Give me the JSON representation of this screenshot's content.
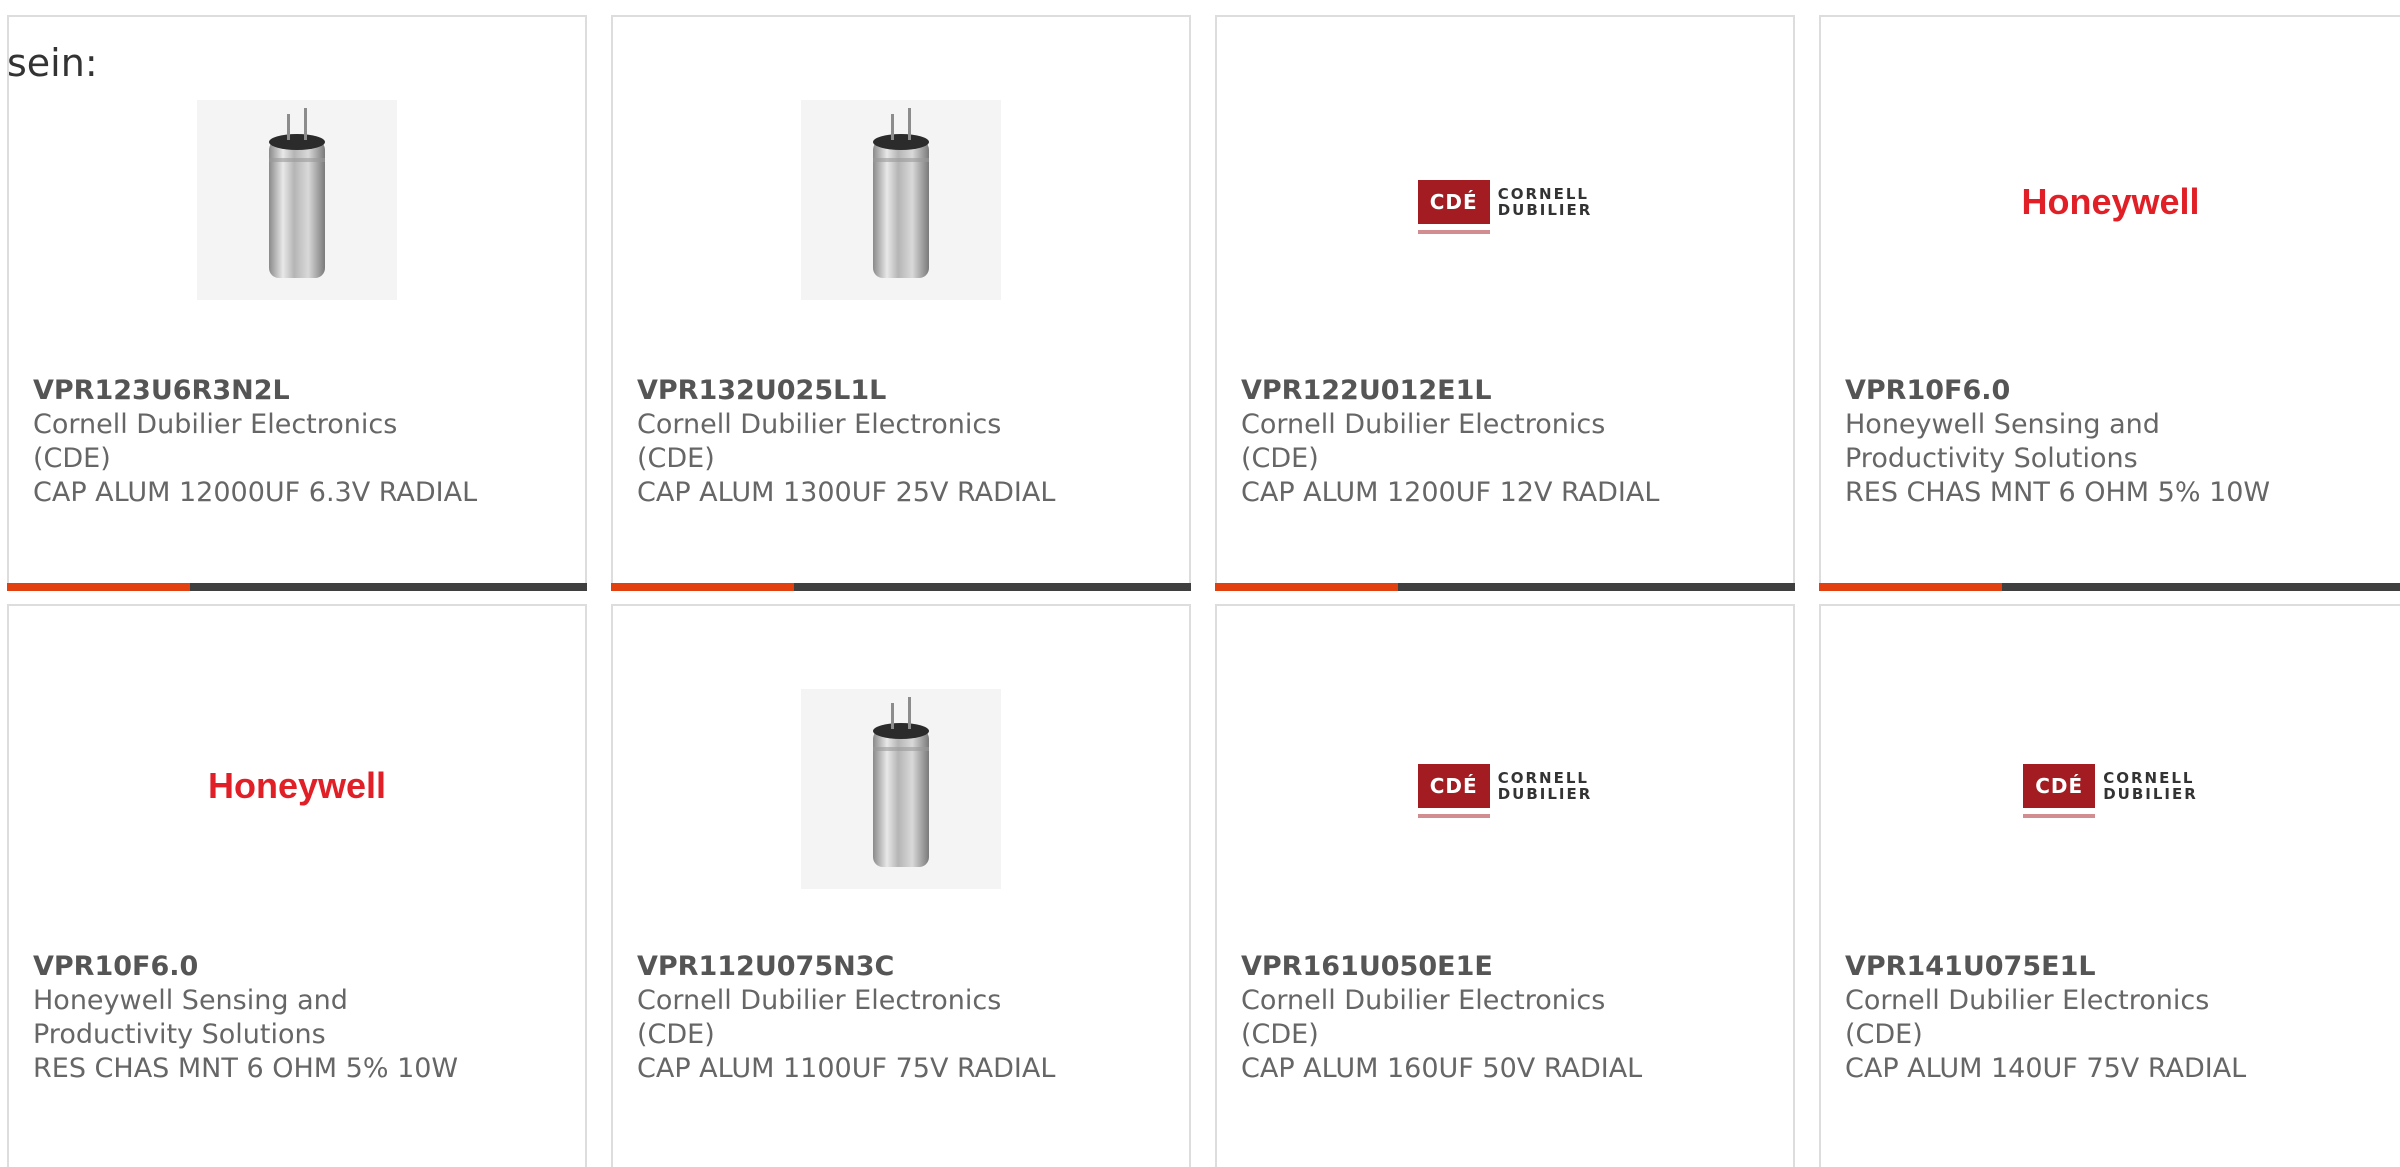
{
  "intro_text": "sein:",
  "colors": {
    "accent": "#e2400f",
    "bar": "#3f3f3f",
    "honeywell_red": "#e01f26",
    "cde_red": "#a31c21"
  },
  "products": [
    {
      "part_number": "VPR123U6R3N2L",
      "manufacturer": "Cornell Dubilier Electronics (CDE)",
      "description": "CAP ALUM 12000UF 6.3V RADIAL",
      "image": "capacitor-photo"
    },
    {
      "part_number": "VPR132U025L1L",
      "manufacturer": "Cornell Dubilier Electronics (CDE)",
      "description": "CAP ALUM 1300UF 25V RADIAL",
      "image": "capacitor-photo"
    },
    {
      "part_number": "VPR122U012E1L",
      "manufacturer": "Cornell Dubilier Electronics (CDE)",
      "description": "CAP ALUM 1200UF 12V RADIAL",
      "image": "cde-logo",
      "logo": {
        "mark": "CDÉ",
        "line1": "CORNELL",
        "line2": "DUBILIER"
      }
    },
    {
      "part_number": "VPR10F6.0",
      "manufacturer": "Honeywell Sensing and Productivity Solutions",
      "description": "RES CHAS MNT 6 OHM 5% 10W",
      "image": "honeywell-logo",
      "logo": {
        "text": "Honeywell"
      }
    },
    {
      "part_number": "VPR10F6.0",
      "manufacturer": "Honeywell Sensing and Productivity Solutions",
      "description": "RES CHAS MNT 6 OHM 5% 10W",
      "image": "honeywell-logo",
      "logo": {
        "text": "Honeywell"
      }
    },
    {
      "part_number": "VPR112U075N3C",
      "manufacturer": "Cornell Dubilier Electronics (CDE)",
      "description": "CAP ALUM 1100UF 75V RADIAL",
      "image": "capacitor-photo"
    },
    {
      "part_number": "VPR161U050E1E",
      "manufacturer": "Cornell Dubilier Electronics (CDE)",
      "description": "CAP ALUM 160UF 50V RADIAL",
      "image": "cde-logo",
      "logo": {
        "mark": "CDÉ",
        "line1": "CORNELL",
        "line2": "DUBILIER"
      }
    },
    {
      "part_number": "VPR141U075E1L",
      "manufacturer": "Cornell Dubilier Electronics (CDE)",
      "description": "CAP ALUM 140UF 75V RADIAL",
      "image": "cde-logo",
      "logo": {
        "mark": "CDÉ",
        "line1": "CORNELL",
        "line2": "DUBILIER"
      }
    }
  ]
}
